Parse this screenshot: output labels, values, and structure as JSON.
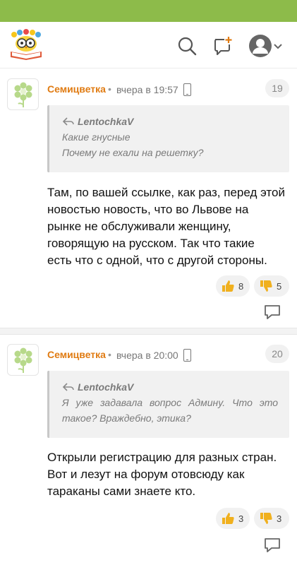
{
  "header": {
    "logo_icon": "flower-owl-logo",
    "search_icon": "search-icon",
    "compose_icon": "add-comment-icon",
    "avatar_icon": "user-avatar-icon",
    "menu_icon": "chevron-down-icon"
  },
  "colors": {
    "accent_green": "#8dbb4a",
    "author_orange": "#e07b12",
    "thumb_yellow": "#f0b01e"
  },
  "comments": [
    {
      "number": "19",
      "author": "Семицветка",
      "dot": "•",
      "time": "вчера в 19:57",
      "device_icon": "mobile-phone-icon",
      "quote": {
        "author": "LentochkaV",
        "lines": [
          "Какие гнусные",
          "Почему не ехали на решетку?"
        ]
      },
      "text_lines": [
        "Там, по вашей ссылке, как раз, перед этой",
        "новостью новость, что во Львове на",
        "рынке не обслуживали женщину,",
        "говорящую на русском. Так что такие",
        "есть что с одной, что с другой стороны."
      ],
      "likes": "8",
      "dislikes": "5"
    },
    {
      "number": "20",
      "author": "Семицветка",
      "dot": "•",
      "time": "вчера в 20:00",
      "device_icon": "mobile-phone-icon",
      "quote": {
        "author": "LentochkaV",
        "lines": [
          "Я уже задавала вопрос Админу. Что это",
          "такое? Враждебно, этика?"
        ]
      },
      "text_lines": [
        "Открыли регистрацию для разных стран.",
        "Вот и лезут на форум отовсюду как",
        "тараканы сами знаете кто."
      ],
      "likes": "3",
      "dislikes": "3"
    }
  ]
}
